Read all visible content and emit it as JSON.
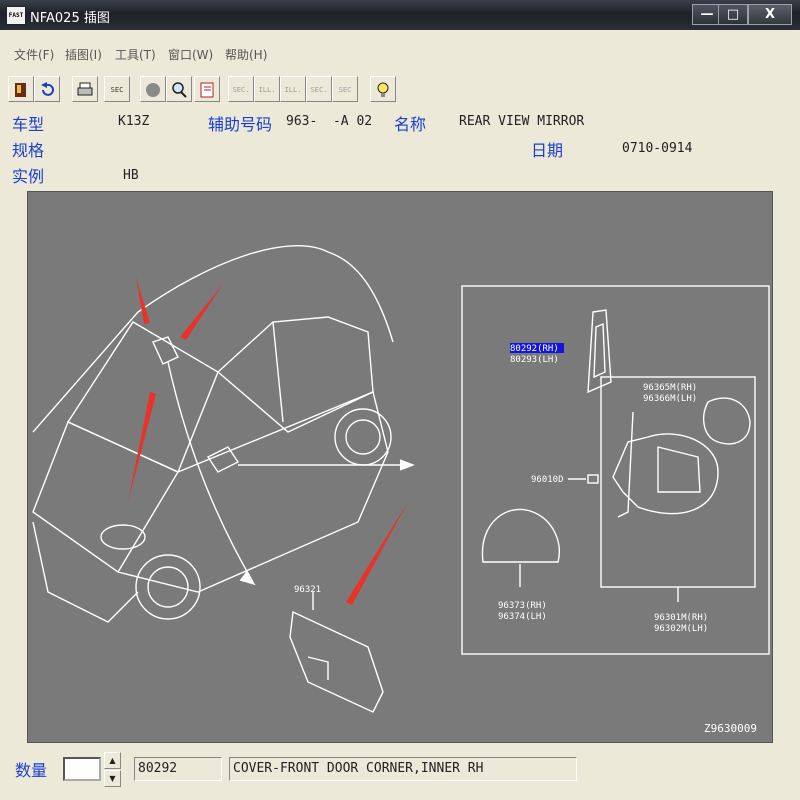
{
  "window": {
    "app_icon_text": "FAST",
    "title": "NFA025  插图",
    "minimize": "—",
    "maximize": "□",
    "close": "X"
  },
  "menu": [
    "文件(F)",
    "插图(I)",
    "工具(T)",
    "窗口(W)",
    "帮助(H)"
  ],
  "toolbar": {
    "buttons": [
      {
        "name": "exit-icon",
        "label": ""
      },
      {
        "name": "undo-icon",
        "label": ""
      },
      {
        "name": "print-icon",
        "label": ""
      },
      {
        "name": "sec-icon",
        "label": "SEC"
      },
      {
        "name": "circle-icon",
        "label": ""
      },
      {
        "name": "zoom-icon",
        "label": ""
      },
      {
        "name": "book-icon",
        "label": ""
      },
      {
        "name": "prev-sec-icon",
        "label": "SEC."
      },
      {
        "name": "prev-ill-icon",
        "label": "ILL."
      },
      {
        "name": "next-ill-icon",
        "label": "ILL."
      },
      {
        "name": "next-sec-icon",
        "label": "SEC."
      },
      {
        "name": "query-sec-icon",
        "label": "SEC"
      },
      {
        "name": "hint-icon",
        "label": ""
      }
    ]
  },
  "info": {
    "model_label": "车型",
    "model_value": "K13Z",
    "aux_label": "辅助号码",
    "aux_value": "963-  -A 02",
    "name_label": "名称",
    "name_value": "REAR VIEW MIRROR",
    "spec_label": "规格",
    "date_label": "日期",
    "date_value": "0710-0914",
    "instance_label": "实例",
    "instance_value": "HB"
  },
  "drawing": {
    "callouts": {
      "p80292": "80292(RH)",
      "p80293": "80293(LH)",
      "p96365": "96365M(RH)",
      "p96366": "96366M(LH)",
      "p96010": "96010D",
      "p96373": "96373(RH)",
      "p96374": "96374(LH)",
      "p96301": "96301M(RH)",
      "p96302": "96302M(LH)",
      "p96321": "96321"
    },
    "drawing_id": "Z9630009"
  },
  "status": {
    "qty_label": "数量",
    "qty_value": "",
    "spin_up": "▲",
    "spin_down": "▼",
    "part_number": "80292",
    "part_description": "COVER-FRONT DOOR CORNER,INNER RH"
  },
  "colors": {
    "label_blue": "#1a3fd4",
    "drawing_bg": "#7a7a7a",
    "highlight": "#1515e0",
    "arrow_red": "#e8322a"
  }
}
